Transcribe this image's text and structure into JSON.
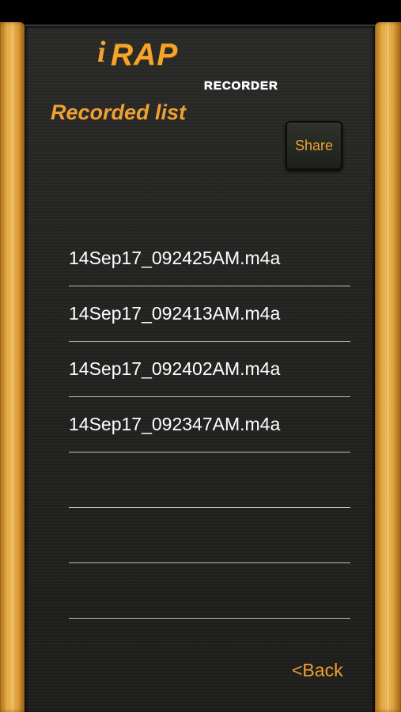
{
  "logo": {
    "i": "i",
    "rap": "RAP",
    "sub": "RECORDER"
  },
  "header": {
    "title": "Recorded list",
    "share_label": "Share"
  },
  "files": [
    "14Sep17_092425AM.m4a",
    "14Sep17_092413AM.m4a",
    "14Sep17_092402AM.m4a",
    "14Sep17_092347AM.m4a",
    "",
    "",
    ""
  ],
  "footer": {
    "back_label": "<Back"
  },
  "colors": {
    "accent": "#f0a032",
    "panel": "#232321",
    "wood": "#e6a83c",
    "divider": "#bdbdbd",
    "text": "#ffffff"
  }
}
